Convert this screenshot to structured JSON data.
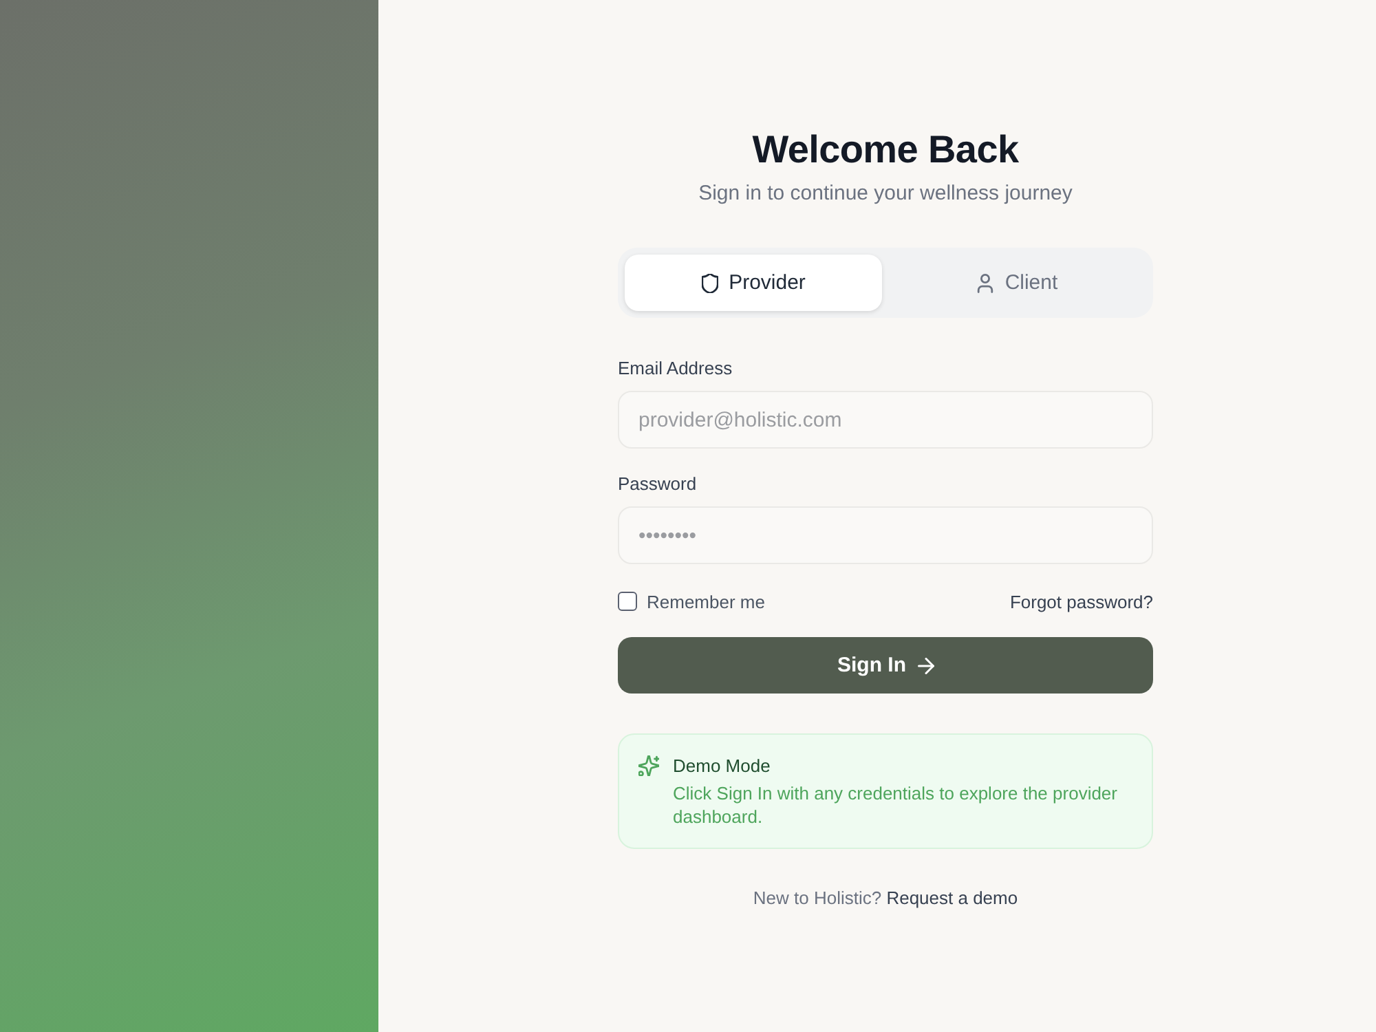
{
  "header": {
    "title": "Welcome Back",
    "subtitle": "Sign in to continue your wellness journey"
  },
  "role_tabs": [
    {
      "label": "Provider",
      "kind": "shield",
      "selected": true
    },
    {
      "label": "Client",
      "kind": "user",
      "selected": false
    }
  ],
  "fields": [
    {
      "label": "Email Address",
      "placeholder": "provider@holistic.com"
    },
    {
      "label": "Password",
      "placeholder": "••••••••"
    }
  ],
  "remember": {
    "label": "Remember me",
    "checked": false
  },
  "forgot_link": "Forgot password?",
  "submit_button": {
    "label": "Sign In"
  },
  "demo_notice": {
    "title": "Demo Mode",
    "text": "Click Sign In with any credentials to explore the provider dashboard."
  },
  "footer": {
    "text": "New to Holistic?",
    "link": "Request a demo"
  }
}
